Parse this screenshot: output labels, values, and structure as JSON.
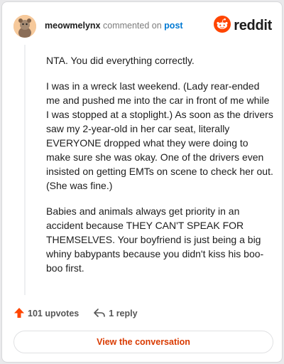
{
  "header": {
    "username": "meowmelynx",
    "verb": "commented on",
    "target": "post",
    "brand": "reddit"
  },
  "comment": {
    "paragraphs": [
      "NTA. You did everything correctly.",
      "I was in a wreck last weekend. (Lady rear-ended me and pushed me into the car in front of me while I was stopped at a stoplight.) As soon as the drivers saw my 2-year-old in her car seat, literally EVERYONE dropped what they were doing to make sure she was okay. One of the drivers even insisted on getting EMTs on scene to check her out. (She was fine.)",
      "Babies and animals always get priority in an accident because THEY CAN'T SPEAK FOR THEMSELVES. Your boyfriend is just being a big whiny babypants because you didn't kiss his boo-boo first."
    ]
  },
  "actions": {
    "upvotes": "101 upvotes",
    "replies": "1 reply"
  },
  "footer": {
    "view_label": "View the conversation"
  },
  "colors": {
    "brand_orange": "#ff4500",
    "link_blue": "#0079d3",
    "button_text": "#d93a00"
  },
  "icons": {
    "upvote": "upvote-arrow-icon",
    "reply": "reply-arrow-icon",
    "brand": "reddit-snoo-icon",
    "avatar": "user-avatar"
  }
}
